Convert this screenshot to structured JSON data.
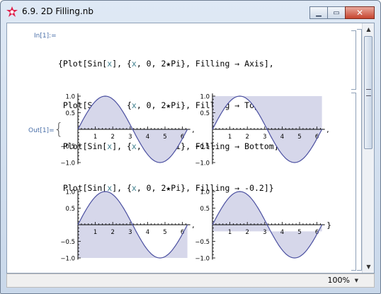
{
  "window": {
    "title": "6.9. 2D Filling.nb"
  },
  "cell": {
    "in_label": "In[1]:=",
    "out_label": "Out[1]=",
    "code_lines": [
      {
        "pre": "{Plot[Sin[",
        "v1": "x",
        "mid": "], {",
        "v2": "x",
        "post": ", 0, 2★Pi}, Filling → Axis],"
      },
      {
        "pre": " Plot[Sin[",
        "v1": "x",
        "mid": "], {",
        "v2": "x",
        "post": ", 0, 2★Pi}, Filling → Top],"
      },
      {
        "pre": " Plot[Sin[",
        "v1": "x",
        "mid": "], {",
        "v2": "x",
        "post": ", 0, 2★Pi}, Filling → Bottom],"
      },
      {
        "pre": " Plot[Sin[",
        "v1": "x",
        "mid": "], {",
        "v2": "x",
        "post": ", 0, 2★Pi}, Filling → -0.2]}"
      }
    ]
  },
  "chart_data": [
    {
      "type": "area",
      "function": "Sin[x]",
      "filling": "Axis",
      "x_range": [
        0,
        6.2832
      ],
      "ylim": [
        -1,
        1
      ],
      "xticks": [
        "1",
        "2",
        "3",
        "4",
        "5",
        "6"
      ],
      "yticks": [
        "1.0",
        "0.5",
        "−0.5",
        "−1.0"
      ]
    },
    {
      "type": "area",
      "function": "Sin[x]",
      "filling": "Top",
      "x_range": [
        0,
        6.2832
      ],
      "ylim": [
        -1,
        1
      ],
      "xticks": [
        "1",
        "2",
        "3",
        "4",
        "5",
        "6"
      ],
      "yticks": [
        "1.0",
        "0.5",
        "−0.5",
        "−1.0"
      ]
    },
    {
      "type": "area",
      "function": "Sin[x]",
      "filling": "Bottom",
      "x_range": [
        0,
        6.2832
      ],
      "ylim": [
        -1,
        1
      ],
      "xticks": [
        "1",
        "2",
        "3",
        "4",
        "5",
        "6"
      ],
      "yticks": [
        "1.0",
        "0.5",
        "−0.5",
        "−1.0"
      ]
    },
    {
      "type": "area",
      "function": "Sin[x]",
      "filling": "-0.2",
      "fill_level": -0.2,
      "x_range": [
        0,
        6.2832
      ],
      "ylim": [
        -1,
        1
      ],
      "xticks": [
        "1",
        "2",
        "3",
        "4",
        "5",
        "6"
      ],
      "yticks": [
        "1.0",
        "0.5",
        "−0.5",
        "−1.0"
      ]
    }
  ],
  "colors": {
    "curve": "#4a4fa0",
    "fill": "#d6d7ea",
    "title_text": "#000000",
    "label": "#4a6fa8"
  },
  "status": {
    "zoom": "100%"
  },
  "icons": {
    "app": "mathematica-star-icon",
    "minimize": "minimize-icon",
    "maximize": "maximize-icon",
    "close": "close-icon"
  }
}
